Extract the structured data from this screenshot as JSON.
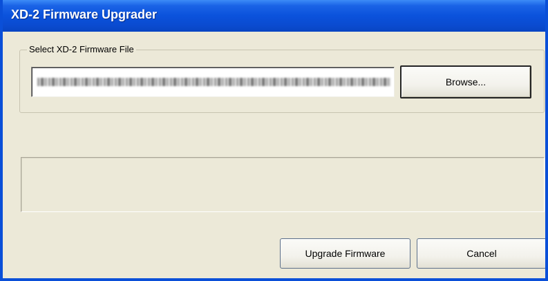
{
  "window": {
    "title": "XD-2 Firmware Upgrader"
  },
  "file_group": {
    "label": "Select XD-2 Firmware File",
    "browse_label": "Browse..."
  },
  "status": {
    "text": ""
  },
  "footer": {
    "upgrade_label": "Upgrade Firmware",
    "cancel_label": "Cancel"
  },
  "colors": {
    "titlebar": "#0b52dc",
    "dialog_bg": "#ece9d8"
  }
}
